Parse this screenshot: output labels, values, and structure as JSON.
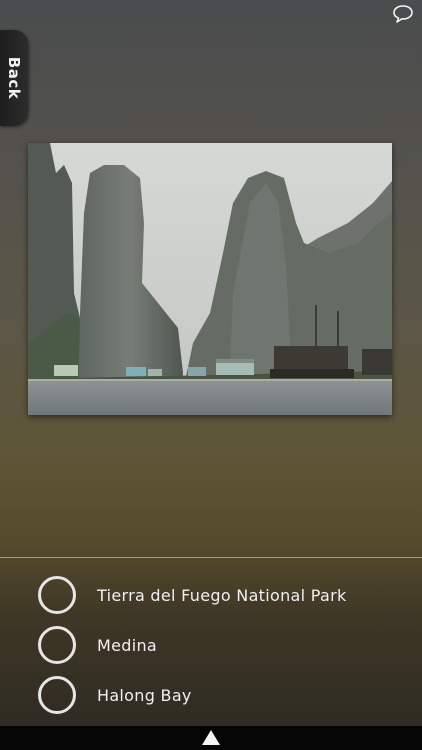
{
  "nav": {
    "back_label": "Back"
  },
  "icons": {
    "comment": "comment-bubble-icon",
    "more": "up-arrow-icon"
  },
  "quiz": {
    "photo_subject": "karst limestone towers over a bay with floating houses and boats",
    "answers": [
      {
        "label": "Tierra del Fuego National Park"
      },
      {
        "label": "Medina"
      },
      {
        "label": "Halong Bay"
      }
    ]
  },
  "colors": {
    "background_top": "#4a4c4d",
    "background_mid": "#5f5637",
    "background_bottom": "#2c2922",
    "answer_text": "#f0f0f0",
    "bottom_bar": "#050505"
  }
}
